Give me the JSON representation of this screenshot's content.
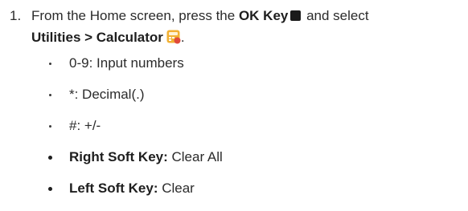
{
  "step": {
    "number": "1.",
    "intro": "From the Home screen, press the ",
    "ok_key": "OK Key",
    "mid": " and select",
    "path": "Utilities > Calculator",
    "end": "."
  },
  "bullets": [
    {
      "label": "",
      "text": "0-9: Input numbers"
    },
    {
      "label": "",
      "text": "*: Decimal(.)"
    },
    {
      "label": "",
      "text": "#: +/-"
    },
    {
      "label": "Right Soft Key:",
      "text": " Clear All"
    },
    {
      "label": "Left Soft Key:",
      "text": " Clear"
    }
  ],
  "icons": {
    "ok_key": "ok-key-square-icon",
    "calculator": "calculator-app-icon"
  },
  "colors": {
    "calculator_icon": "#f2b134",
    "calculator_badge": "#e04a3a"
  }
}
